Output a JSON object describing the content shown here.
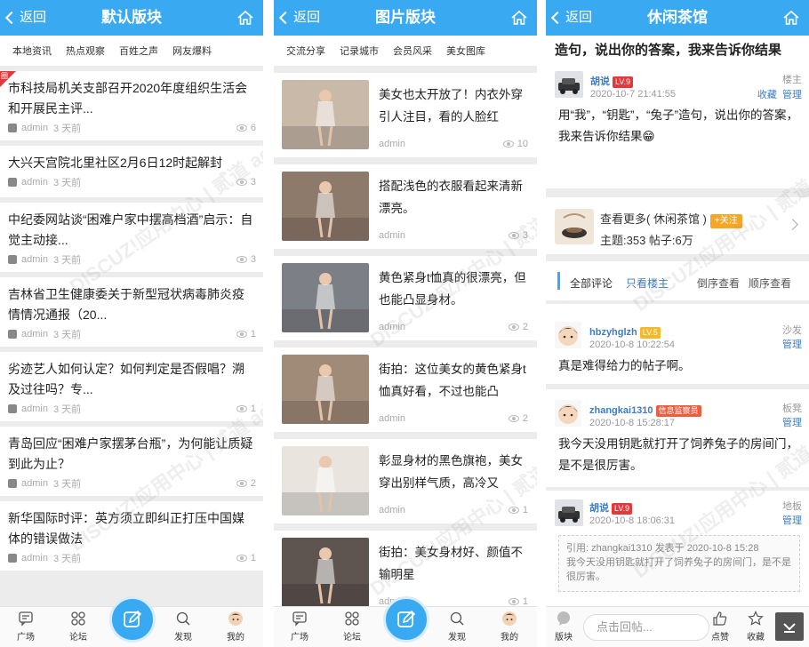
{
  "panel1": {
    "header": {
      "back_label": "返回",
      "title": "默认版块"
    },
    "tabs": [
      "本地资讯",
      "热点观察",
      "百姓之声",
      "网友爆料"
    ],
    "new_tag": "圈",
    "items": [
      {
        "title": "市科技局机关支部召开2020年度组织生活会和开展民主评...",
        "author": "admin",
        "time": "3 天前",
        "views": "6",
        "is_new": true
      },
      {
        "title": "大兴天宫院北里社区2月6日12时起解封",
        "author": "admin",
        "time": "3 天前",
        "views": "3"
      },
      {
        "title": "中纪委网站谈“困难户家中摆高档酒”启示：自觉主动接...",
        "author": "admin",
        "time": "3 天前",
        "views": "3"
      },
      {
        "title": "吉林省卫生健康委关于新型冠状病毒肺炎疫情情况通报（20...",
        "author": "admin",
        "time": "3 天前",
        "views": "1"
      },
      {
        "title": "劣迹艺人如何认定？如何判定是否假唱？溯及过往吗？专...",
        "author": "admin",
        "time": "3 天前",
        "views": "1"
      },
      {
        "title": "青岛回应“困难户家摆茅台瓶”，为何能让质疑到此为止？",
        "author": "admin",
        "time": "3 天前",
        "views": "2"
      },
      {
        "title": "新华国际时评：英方须立即纠正打压中国媒体的错误做法",
        "author": "admin",
        "time": "3 天前",
        "views": "1"
      }
    ]
  },
  "panel2": {
    "header": {
      "back_label": "返回",
      "title": "图片版块"
    },
    "tabs": [
      "交流分享",
      "记录城市",
      "会员风采",
      "美女图库"
    ],
    "items": [
      {
        "title": "美女也太开放了！内衣外穿引人注目，看的人脸红",
        "author": "admin",
        "views": "10",
        "img_color": "#c9b9a8"
      },
      {
        "title": "搭配浅色的衣服看起来清新漂亮。",
        "author": "admin",
        "views": "3",
        "img_color": "#8d7a6a"
      },
      {
        "title": "黄色紧身t恤真的很漂亮，但也能凸显身材。",
        "author": "admin",
        "views": "2",
        "img_color": "#7d7f86"
      },
      {
        "title": "街拍：这位美女的黄色紧身t恤真好看，不过也能凸",
        "author": "admin",
        "views": "2",
        "img_color": "#a08a78"
      },
      {
        "title": "彰显身材的黑色旗袍，美女穿出别样气质，高冷又",
        "author": "admin",
        "views": "1",
        "img_color": "#e9e4de"
      },
      {
        "title": "街拍：美女身材好、颜值不输明星",
        "author": "admin",
        "views": "1",
        "img_color": "#5e5450"
      }
    ]
  },
  "panel3": {
    "header": {
      "back_label": "返回",
      "title": "休闲茶馆"
    },
    "thread_title": "造句，说出你的答案，我来告诉你结果",
    "op": {
      "name": "胡说",
      "level": "LV.9",
      "time": "2020-10-7 21:41:55",
      "floor": "楼主",
      "manage": "管理",
      "fav": "收藏",
      "content": "用“我”，“钥匙”，“兔子”造句，说出你的答案，我来告诉你结果😁"
    },
    "forum": {
      "more": "查看更多( 休闲茶馆 )",
      "follow": "+关注",
      "stats": "主题:353 帖子:6万"
    },
    "filter": {
      "all": "全部评论",
      "only_op": "只看楼主",
      "desc": "倒序查看",
      "asc": "顺序查看"
    },
    "replies": [
      {
        "name": "hbzyhglzh",
        "level": "LV.5",
        "time": "2020-10-8 10:22:54",
        "floor": "沙发",
        "manage": "管理",
        "content": "真是难得给力的帖子啊。"
      },
      {
        "name": "zhangkai1310",
        "level": "信息监察员",
        "time": "2020-10-8 15:28:17",
        "floor": "板凳",
        "manage": "管理",
        "content": "我今天没用钥匙就打开了饲养兔子的房间门，是不是很厉害。"
      },
      {
        "name": "胡说",
        "level": "LV.9",
        "time": "2020-10-8 18:06:31",
        "floor": "地板",
        "manage": "管理",
        "quote_head": "引用: zhangkai1310 发表于 2020-10-8 15:28",
        "quote_body": "我今天没用钥匙就打开了饲养兔子的房间门，是不是很厉害。"
      }
    ],
    "bottom": {
      "forum": "版块",
      "placeholder": "点击回帖...",
      "like": "点赞",
      "fav": "收藏"
    }
  },
  "tabbar": {
    "square": "广场",
    "forum": "论坛",
    "discover": "发现",
    "mine": "我的"
  },
  "watermark": "DISCUZ!应用中心 | 贰道 addon.dismall.com",
  "colors": {
    "primary": "#39a9f2",
    "level_red": "#e4393c",
    "level_yellow": "#f5b82a",
    "link_blue": "#3c7cc2"
  }
}
